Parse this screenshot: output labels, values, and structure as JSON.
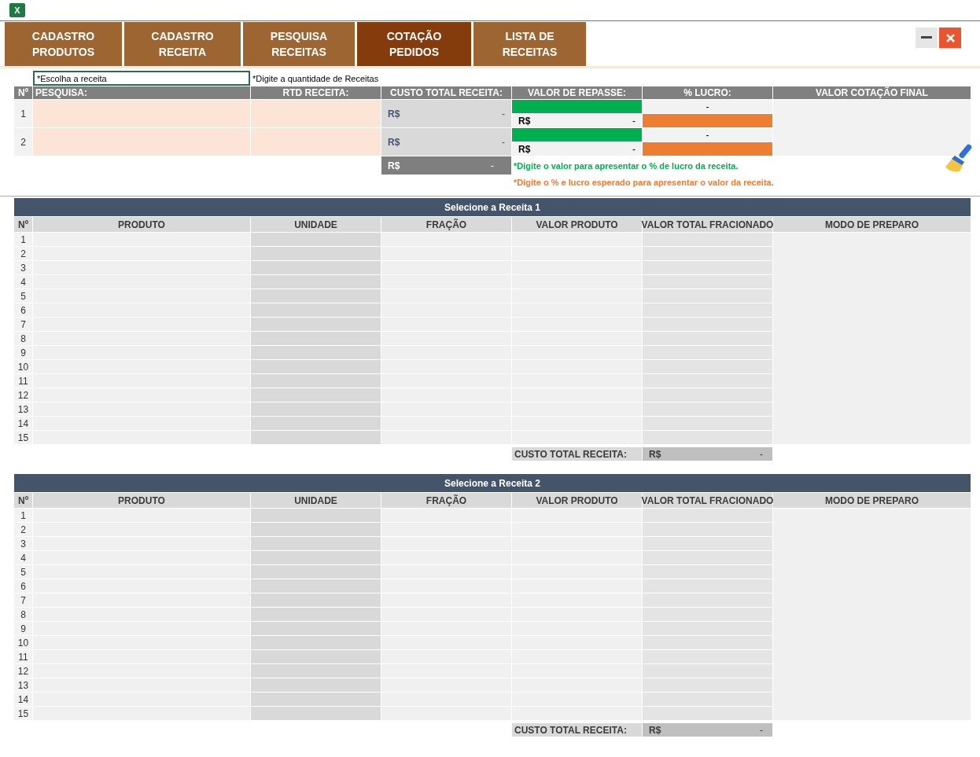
{
  "app_icon": {
    "letter": "X"
  },
  "nav": [
    {
      "label": "CADASTRO PRODUTOS",
      "selected": false
    },
    {
      "label": "CADASTRO RECEITA",
      "selected": false
    },
    {
      "label": "PESQUISA RECEITAS",
      "selected": false
    },
    {
      "label": "COTAÇÃO PEDIDOS",
      "selected": true
    },
    {
      "label": "LISTA DE RECEITAS",
      "selected": false
    }
  ],
  "quote": {
    "search_placeholder": "*Escolha a receita",
    "quantity_hint": "*Digite a quantidade de Receitas",
    "columns": [
      "Nº",
      "PESQUISA:",
      "RTD RECEITA:",
      "CUSTO TOTAL RECEITA:",
      "VALOR DE REPASSE:",
      "% LUCRO:",
      "VALOR COTAÇÃO FINAL"
    ],
    "rows": [
      {
        "number": "1",
        "cost_currency": "R$",
        "cost_value": "-",
        "resale_currency": "R$",
        "resale_value": "-",
        "profit_value": "-"
      },
      {
        "number": "2",
        "cost_currency": "R$",
        "cost_value": "-",
        "resale_currency": "R$",
        "resale_value": "-",
        "profit_value": "-"
      }
    ],
    "total": {
      "currency": "R$",
      "value": "-"
    },
    "hints": [
      {
        "text": "*Digite o valor para apresentar o % de lucro da receita.",
        "color": "#00b050"
      },
      {
        "text": "*Digite o % e lucro esperado para apresentar o valor da receita.",
        "color": "#ed7d31"
      }
    ]
  },
  "recipes": [
    {
      "title": "Selecione a Receita 1",
      "columns": [
        "Nº",
        "PRODUTO",
        "UNIDADE",
        "FRAÇÃO",
        "VALOR PRODUTO",
        "VALOR TOTAL FRACIONADO",
        "MODO DE PREPARO"
      ],
      "rows": [
        "1",
        "2",
        "3",
        "4",
        "5",
        "6",
        "7",
        "8",
        "9",
        "10",
        "11",
        "12",
        "13",
        "14",
        "15"
      ],
      "total": {
        "label": "CUSTO TOTAL RECEITA:",
        "currency": "R$",
        "value": "-"
      }
    },
    {
      "title": "Selecione a Receita 2",
      "columns": [
        "Nº",
        "PRODUTO",
        "UNIDADE",
        "FRAÇÃO",
        "VALOR PRODUTO",
        "VALOR TOTAL FRACIONADO",
        "MODO DE PREPARO"
      ],
      "rows": [
        "1",
        "2",
        "3",
        "4",
        "5",
        "6",
        "7",
        "8",
        "9",
        "10",
        "11",
        "12",
        "13",
        "14",
        "15"
      ],
      "total": {
        "label": "CUSTO TOTAL RECEITA:",
        "currency": "R$",
        "value": "-"
      }
    }
  ]
}
